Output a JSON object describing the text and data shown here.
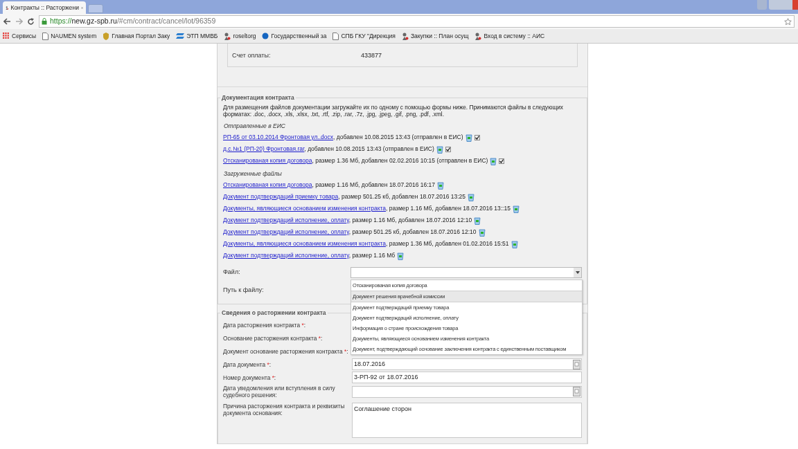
{
  "browser": {
    "tab": {
      "title": "Контракты :: Расторжени",
      "selected": true
    },
    "url": {
      "scheme": "https://",
      "host": "new.gz-spb.ru",
      "path": "/#cm/contract/cancel/lot/96359"
    },
    "bookmarks": [
      {
        "label": "Сервисы",
        "kind": "apps"
      },
      {
        "label": "NAUMEN system",
        "kind": "page"
      },
      {
        "label": "Главная Портал Заку",
        "kind": "emblem"
      },
      {
        "label": "ЭТП ММВБ",
        "kind": "etp"
      },
      {
        "label": "roseltorg",
        "kind": "person"
      },
      {
        "label": "Государственный за",
        "kind": "globe"
      },
      {
        "label": "СПБ ГКУ \"Дирекция",
        "kind": "page"
      },
      {
        "label": "Закупки :: План осущ",
        "kind": "person"
      },
      {
        "label": "Вход в систему :: АИС",
        "kind": "person"
      }
    ]
  },
  "payment": {
    "label": "Счет оплаты:",
    "value": "433877"
  },
  "documents": {
    "legend": "Документация контракта",
    "intro": "Для размещения файлов документации загружайте их по одному с помощью формы ниже. Принимаются файлы в следующих форматах: .doc, .docx, .xls, .xlsx, .txt, .rtf, .zip, .rar, .7z, .jpg, .jpeg, .gif, .png, .pdf, .xml.",
    "groups": [
      {
        "title": "Отправленные в ЕИС",
        "files": [
          {
            "link": "РП-65 от 03.10.2014 Фронтовая ул..docx",
            "details": ", добавлен 10.08.2015 13:43 (отправлен в ЕИС)",
            "checked": true
          },
          {
            "link": "д.с.№1 (РП-20) Фронтовая.rar",
            "details": ", добавлен 10.08.2015 13:43 (отправлен в ЕИС)",
            "checked": true
          },
          {
            "link": "Отсканированая копия договора",
            "details": ", размер 1.36 Мб, добавлен 02.02.2016 10:15 (отправлен в ЕИС)",
            "checked": true
          }
        ]
      },
      {
        "title": "Загруженные файлы",
        "files": [
          {
            "link": "Отсканированая копия договора",
            "details": ", размер 1.16 Мб, добавлен 18.07.2016 16:17"
          },
          {
            "link": "Документ подтверждаций приемку товара",
            "details": ", размер 501.25 кб, добавлен 18.07.2016 13:25"
          },
          {
            "link": "Документы, являющиеся основанием изменения контракта",
            "details": ", размер 1.16 Мб, добавлен 18.07.2016 13::15"
          },
          {
            "link": "Документ подтверждаций исполнение, оплату",
            "details": ", размер 1.16 Мб, добавлен 18.07.2016 12:10"
          },
          {
            "link": "Документ подтверждаций исполнение, оплату",
            "details": ", размер 501.25 кб, добавлен 18.07.2016 12:10"
          },
          {
            "link": "Документы, являющиеся основанием изменения контракта",
            "details": ", размер 1.36 Мб, добавлен 01.02.2016 15:51"
          },
          {
            "link": "Документ подтверждаций исполнение, оплату",
            "details": ", размер 1.16 Мб"
          }
        ]
      }
    ],
    "file_label": "Файл:",
    "path_label": "Путь к файлу:",
    "options": [
      {
        "label": "Отсканированая копия договора",
        "selected": false
      },
      {
        "label": "Документ решения врачебной комиссии",
        "selected": true
      },
      {
        "label": "Документ подтверждаций приемку товара",
        "selected": false
      },
      {
        "label": "Документ подтверждаций исполнение, оплату",
        "selected": false
      },
      {
        "label": "Информация о стране происхождения товара",
        "selected": false
      },
      {
        "label": "Документы, являющиеся основанием изменения контракта",
        "selected": false
      },
      {
        "label": "Документ, подтверждающий основание заключения контракта с единственным поставщиком",
        "selected": false
      }
    ]
  },
  "termination": {
    "legend": "Сведения о расторжении контракта",
    "fields": [
      {
        "label": "Дата расторжения контракта",
        "mark": "*",
        "suffix": ":"
      },
      {
        "label": "Основание расторжения контракта",
        "mark": "*",
        "suffix": ":"
      },
      {
        "label": "Документ основание расторжения контракта",
        "mark": "*",
        "suffix": ":"
      },
      {
        "label": "Дата документа",
        "mark": "*",
        "suffix": ":",
        "kind": "date",
        "value": "18.07.2016"
      },
      {
        "label": "Номер документа",
        "mark": "*",
        "suffix": ":",
        "kind": "text",
        "value": "3-РП-92 от 18.07.2016"
      },
      {
        "label": "Дата уведомления или вступления в силу судебного решения:",
        "kind": "date"
      },
      {
        "label": "Причина расторжения контракта и реквизиты документа основания:",
        "kind": "textarea",
        "value": "Соглашение сторон"
      }
    ]
  }
}
